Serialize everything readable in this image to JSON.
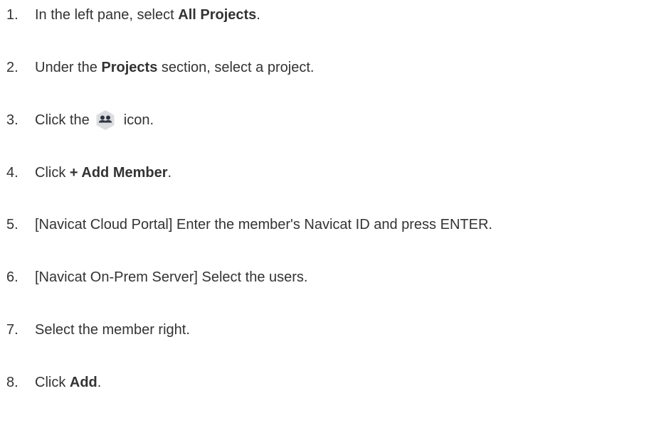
{
  "steps": [
    {
      "num": "1.",
      "pre": "In the left pane, select ",
      "bold": "All Projects",
      "post": "."
    },
    {
      "num": "2.",
      "pre": "Under the ",
      "bold": "Projects",
      "post": " section, select a project."
    },
    {
      "num": "3.",
      "pre": "Click the ",
      "icon": "members-icon",
      "post": " icon."
    },
    {
      "num": "4.",
      "pre": "Click ",
      "bold": "+ Add Member",
      "post": "."
    },
    {
      "num": "5.",
      "text": "[Navicat Cloud Portal] Enter the member's Navicat ID and press ENTER."
    },
    {
      "num": "6.",
      "text": "[Navicat On-Prem Server] Select the users."
    },
    {
      "num": "7.",
      "text": "Select the member right."
    },
    {
      "num": "8.",
      "pre": "Click ",
      "bold": "Add",
      "post": "."
    }
  ],
  "colors": {
    "text": "#333333",
    "icon_bg": "#dcdde0",
    "icon_fg": "#2f3540"
  }
}
